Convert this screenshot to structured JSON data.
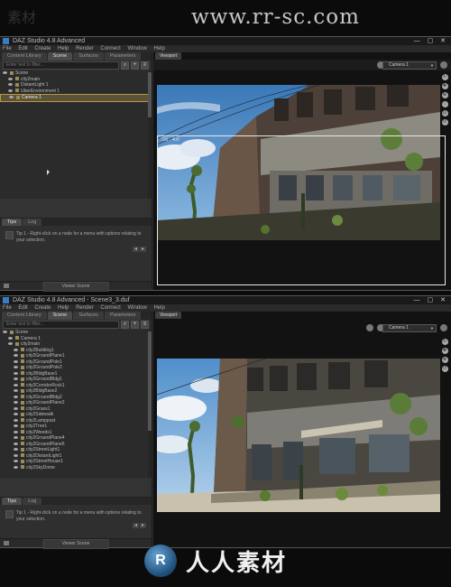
{
  "watermark": {
    "top_text": "www.rr-sc.com",
    "top_left_text": "素材",
    "bottom_text": "人人素材",
    "bottom_logo_text": "R"
  },
  "window_controls": "— ▢ ✕",
  "screenshots": [
    {
      "title": "DAZ Studio 4.8 Advanced",
      "menu": [
        "File",
        "Edit",
        "Create",
        "Help",
        "Render",
        "Connect",
        "Window",
        "Help"
      ],
      "left_tabs": [
        "Content Library",
        "Scene",
        "Surfaces",
        "Parameters"
      ],
      "active_tab": "Scene",
      "search_placeholder": "Enter text to filter...",
      "tree": [
        {
          "label": "Scene",
          "selected": false
        },
        {
          "label": "city2main",
          "selected": false
        },
        {
          "label": "DistantLight 1",
          "selected": false
        },
        {
          "label": "UberEnvironment 1",
          "selected": false
        },
        {
          "label": "Camera 1",
          "selected": true
        }
      ],
      "tips_tabs": [
        "Tips",
        "Log"
      ],
      "tip_text": "Tip 1 - Right-click on a node for a menu with options relating to your selection.",
      "tips_mode": "Viewer Scene",
      "viewport_tab": "Viewport",
      "camera": "Camera 1",
      "dimension_label": "700 : 400",
      "scene_colors": {
        "sky": "#4f8fca",
        "building": "#5a4a3e"
      }
    },
    {
      "title": "DAZ Studio 4.8 Advanced - Scene3_3.duf",
      "menu": [
        "File",
        "Edit",
        "Create",
        "Help",
        "Render",
        "Connect",
        "Window",
        "Help"
      ],
      "left_tabs": [
        "Content Library",
        "Scene",
        "Surfaces",
        "Parameters"
      ],
      "active_tab": "Scene",
      "search_placeholder": "Enter text to filter...",
      "tree": [
        {
          "label": "Scene",
          "selected": false
        },
        {
          "label": "Camera 1",
          "selected": false
        },
        {
          "label": "city2main",
          "selected": false
        },
        {
          "label": "city2Building1",
          "selected": false
        },
        {
          "label": "city2GroundPlane1",
          "selected": false
        },
        {
          "label": "city2GroundPole1",
          "selected": false
        },
        {
          "label": "city2GroundPole2",
          "selected": false
        },
        {
          "label": "city2BldgBase1",
          "selected": false
        },
        {
          "label": "city2GroundBldg1",
          "selected": false
        },
        {
          "label": "city2CorridorRock1",
          "selected": false
        },
        {
          "label": "city2BldgBase2",
          "selected": false
        },
        {
          "label": "city2GroundBldg2",
          "selected": false
        },
        {
          "label": "city2GroundPlane2",
          "selected": false
        },
        {
          "label": "city2Grass1",
          "selected": false
        },
        {
          "label": "city2Sidewalk",
          "selected": false
        },
        {
          "label": "city2Lamppost",
          "selected": false
        },
        {
          "label": "city2Tree1",
          "selected": false
        },
        {
          "label": "city2Weeds1",
          "selected": false
        },
        {
          "label": "city2GroundPlane4",
          "selected": false
        },
        {
          "label": "city2GroundPlane5",
          "selected": false
        },
        {
          "label": "city2StreetLight1",
          "selected": false
        },
        {
          "label": "city2DistantLight1",
          "selected": false
        },
        {
          "label": "city2StreetHouse1",
          "selected": false
        },
        {
          "label": "city2SkyDome",
          "selected": false
        }
      ],
      "tips_tabs": [
        "Tips",
        "Log"
      ],
      "tip_text": "Tip 1 - Right-click on a node for a menu with options relating to your selection.",
      "tips_mode": "Viewer Scene",
      "viewport_tab": "Viewport",
      "camera": "Camera 1",
      "scene_colors": {
        "sky": "#6fa8d9",
        "building": "#4e4a45"
      }
    }
  ]
}
